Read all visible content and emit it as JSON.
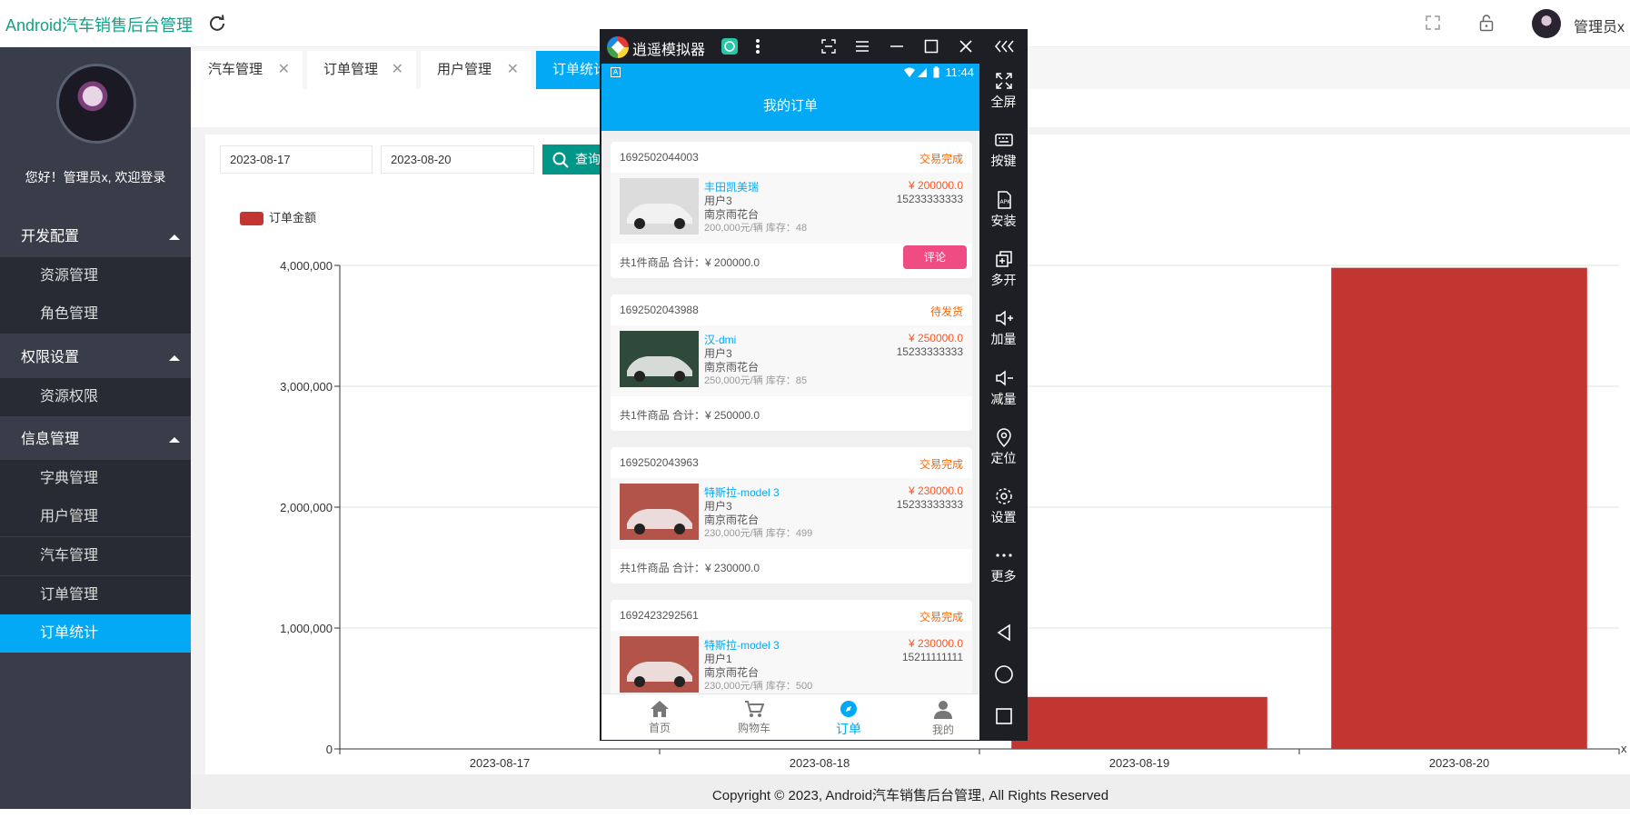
{
  "header": {
    "app_title": "Android汽车销售后台管理",
    "user_name": "管理员x"
  },
  "sidebar": {
    "welcome": "您好！管理员x, 欢迎登录",
    "groups": [
      {
        "label": "开发配置",
        "items": [
          {
            "label": "资源管理"
          },
          {
            "label": "角色管理"
          }
        ]
      },
      {
        "label": "权限设置",
        "items": [
          {
            "label": "资源权限"
          }
        ]
      },
      {
        "label": "信息管理",
        "items": [
          {
            "label": "字典管理"
          },
          {
            "label": "用户管理"
          },
          {
            "label": "汽车管理"
          },
          {
            "label": "订单管理"
          },
          {
            "label": "订单统计"
          }
        ]
      }
    ],
    "active_item": "订单统计"
  },
  "tabs": [
    {
      "label": "汽车管理"
    },
    {
      "label": "订单管理"
    },
    {
      "label": "用户管理"
    },
    {
      "label": "订单统计"
    }
  ],
  "filters": {
    "start_date": "2023-08-17",
    "end_date": "2023-08-20",
    "query_label": "查询"
  },
  "chart_data": {
    "type": "bar",
    "legend": [
      "订单金额"
    ],
    "categories": [
      "2023-08-17",
      "2023-08-18",
      "2023-08-19",
      "2023-08-20"
    ],
    "series": [
      {
        "name": "订单金额",
        "values": [
          0,
          0,
          430000,
          3980000
        ],
        "color": "#c23531"
      }
    ],
    "yticks": [
      "0",
      "1,000,000",
      "2,000,000",
      "3,000,000",
      "4,000,000"
    ],
    "ylim": [
      0,
      4000000
    ],
    "xlabel": "x",
    "grid": true,
    "legend_position": "top-left"
  },
  "footer": {
    "copyright": "Copyright © 2023, Android汽车销售后台管理, All Rights Reserved"
  },
  "emulator": {
    "title": "逍遥模拟器",
    "side_buttons": [
      {
        "label": "全屏",
        "icon": "fullscreen-icon"
      },
      {
        "label": "按键",
        "icon": "keyboard-icon"
      },
      {
        "label": "安装",
        "icon": "apk-icon"
      },
      {
        "label": "多开",
        "icon": "multi-instance-icon"
      },
      {
        "label": "加量",
        "icon": "volume-up-icon"
      },
      {
        "label": "减量",
        "icon": "volume-down-icon"
      },
      {
        "label": "定位",
        "icon": "location-icon"
      },
      {
        "label": "设置",
        "icon": "settings-icon"
      },
      {
        "label": "更多",
        "icon": "more-icon"
      }
    ],
    "phone": {
      "status_time": "11:44",
      "page_title": "我的订单",
      "orders": [
        {
          "order_no": "1692502044003",
          "status": "交易完成",
          "name": "丰田凯美瑞",
          "price": "¥ 200000.0",
          "user": "用户3",
          "phone": "15233333333",
          "address": "南京雨花台",
          "stock": "200,000元/辆 库存：48",
          "summary": "共1件商品 合计：¥ 200000.0",
          "action": "评论",
          "img_color": "#dcdcdc"
        },
        {
          "order_no": "1692502043988",
          "status": "待发货",
          "name": "汉-dmi",
          "price": "¥ 250000.0",
          "user": "用户3",
          "phone": "15233333333",
          "address": "南京雨花台",
          "stock": "250,000元/辆 库存：85",
          "summary": "共1件商品 合计：¥ 250000.0",
          "action": "",
          "img_color": "#2f4a3a"
        },
        {
          "order_no": "1692502043963",
          "status": "交易完成",
          "name": "特斯拉-model 3",
          "price": "¥ 230000.0",
          "user": "用户3",
          "phone": "15233333333",
          "address": "南京雨花台",
          "stock": "230,000元/辆 库存：499",
          "summary": "共1件商品 合计：¥ 230000.0",
          "action": "",
          "img_color": "#b3544a"
        },
        {
          "order_no": "1692423292561",
          "status": "交易完成",
          "name": "特斯拉-model 3",
          "price": "¥ 230000.0",
          "user": "用户1",
          "phone": "15211111111",
          "address": "南京雨花台",
          "stock": "230,000元/辆 库存：500",
          "summary": "",
          "action": "",
          "img_color": "#b3544a"
        }
      ],
      "bottom_nav": [
        {
          "label": "首页",
          "icon": "home-icon"
        },
        {
          "label": "购物车",
          "icon": "cart-icon"
        },
        {
          "label": "订单",
          "icon": "compass-icon"
        },
        {
          "label": "我的",
          "icon": "profile-icon"
        }
      ],
      "active_nav": "订单"
    }
  }
}
